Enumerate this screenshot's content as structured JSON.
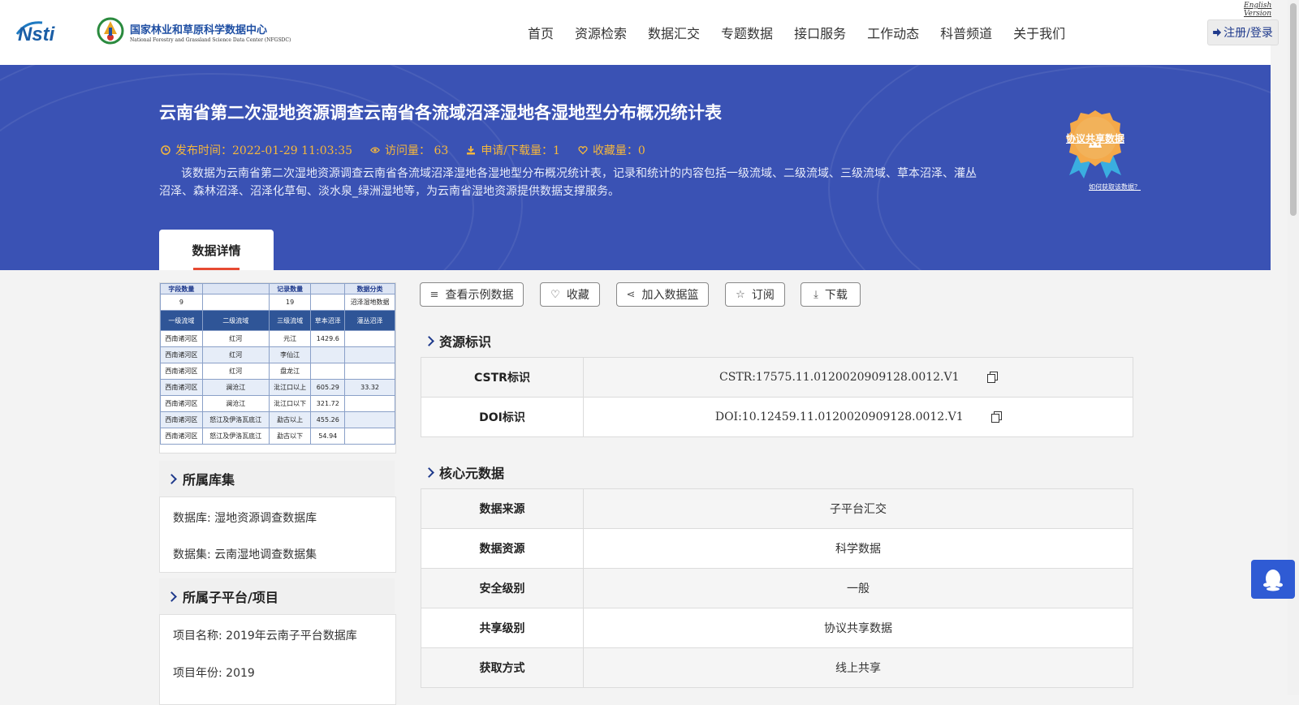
{
  "header": {
    "logo_text": "Nsti",
    "org_name": "国家林业和草原科学数据中心",
    "org_name_en": "National Forestry and Grassland Science Data Center (NFGSDC)",
    "english_link": "English Version",
    "nav": [
      "首页",
      "资源检索",
      "数据汇交",
      "专题数据",
      "接口服务",
      "工作动态",
      "科普频道",
      "关于我们"
    ],
    "login_label": "注册/登录"
  },
  "banner": {
    "title": "云南省第二次湿地资源调查云南省各流域沼泽湿地各湿地型分布概况统计表",
    "publish": "发布时间：2022-01-29 11:03:35",
    "visits": "访问量： 63",
    "downloads": "申请/下载量：1",
    "favorites": "收藏量：0",
    "description": "该数据为云南省第二次湿地资源调查云南省各流域沼泽湿地各湿地型分布概况统计表，记录和统计的内容包括一级流域、二级流域、三级流域、草本沼泽、灌丛沼泽、森林沼泽、沼泽化草甸、淡水泉_绿洲湿地等，为云南省湿地资源提供数据支撑服务。",
    "badge": "协议共享数据",
    "howto": "如何获取该数据？",
    "tab": "数据详情"
  },
  "preview": {
    "head1": [
      "字段数量",
      "",
      "记录数量",
      "",
      "数据分类"
    ],
    "head1_vals": [
      "9",
      "",
      "19",
      "",
      "沼泽湿地数据"
    ],
    "cols": [
      "一级流域",
      "二级流域",
      "三级流域",
      "草本沼泽",
      "灌丛沼泽"
    ],
    "rows": [
      [
        "西南诸河区",
        "红河",
        "元江",
        "1429.6",
        ""
      ],
      [
        "西南诸河区",
        "红河",
        "李仙江",
        "",
        ""
      ],
      [
        "西南诸河区",
        "红河",
        "盘龙江",
        "",
        ""
      ],
      [
        "西南诸河区",
        "澜沧江",
        "沘江口以上",
        "605.29",
        "33.32"
      ],
      [
        "西南诸河区",
        "澜沧江",
        "沘江口以下",
        "321.72",
        ""
      ],
      [
        "西南诸河区",
        "怒江及伊洛瓦底江",
        "勐古以上",
        "455.26",
        ""
      ],
      [
        "西南诸河区",
        "怒江及伊洛瓦底江",
        "勐古以下",
        "54.94",
        ""
      ]
    ]
  },
  "library": {
    "title": "所属库集",
    "database": "数据库: 湿地资源调查数据库",
    "dataset": "数据集: 云南湿地调查数据集"
  },
  "platform": {
    "title": "所属子平台/项目",
    "project": "项目名称: 2019年云南子平台数据库",
    "year": "项目年份: 2019"
  },
  "actions": [
    "查看示例数据",
    "收藏",
    "加入数据篮",
    "订阅",
    "下载"
  ],
  "resource_id": {
    "title": "资源标识",
    "rows": [
      {
        "k": "CSTR标识",
        "v": "CSTR:17575.11.0120020909128.0012.V1"
      },
      {
        "k": "DOI标识",
        "v": "DOI:10.12459.11.0120020909128.0012.V1"
      }
    ]
  },
  "core_meta": {
    "title": "核心元数据",
    "rows": [
      {
        "k": "数据来源",
        "v": "子平台汇交"
      },
      {
        "k": "数据资源",
        "v": "科学数据"
      },
      {
        "k": "安全级别",
        "v": "一般"
      },
      {
        "k": "共享级别",
        "v": "协议共享数据"
      },
      {
        "k": "获取方式",
        "v": "线上共享"
      }
    ]
  },
  "colors": {
    "banner": "#3a52b4",
    "accent_orange": "#f5b73c",
    "tab_underline": "#e64a32",
    "nav_blue": "#1f3a8c"
  }
}
